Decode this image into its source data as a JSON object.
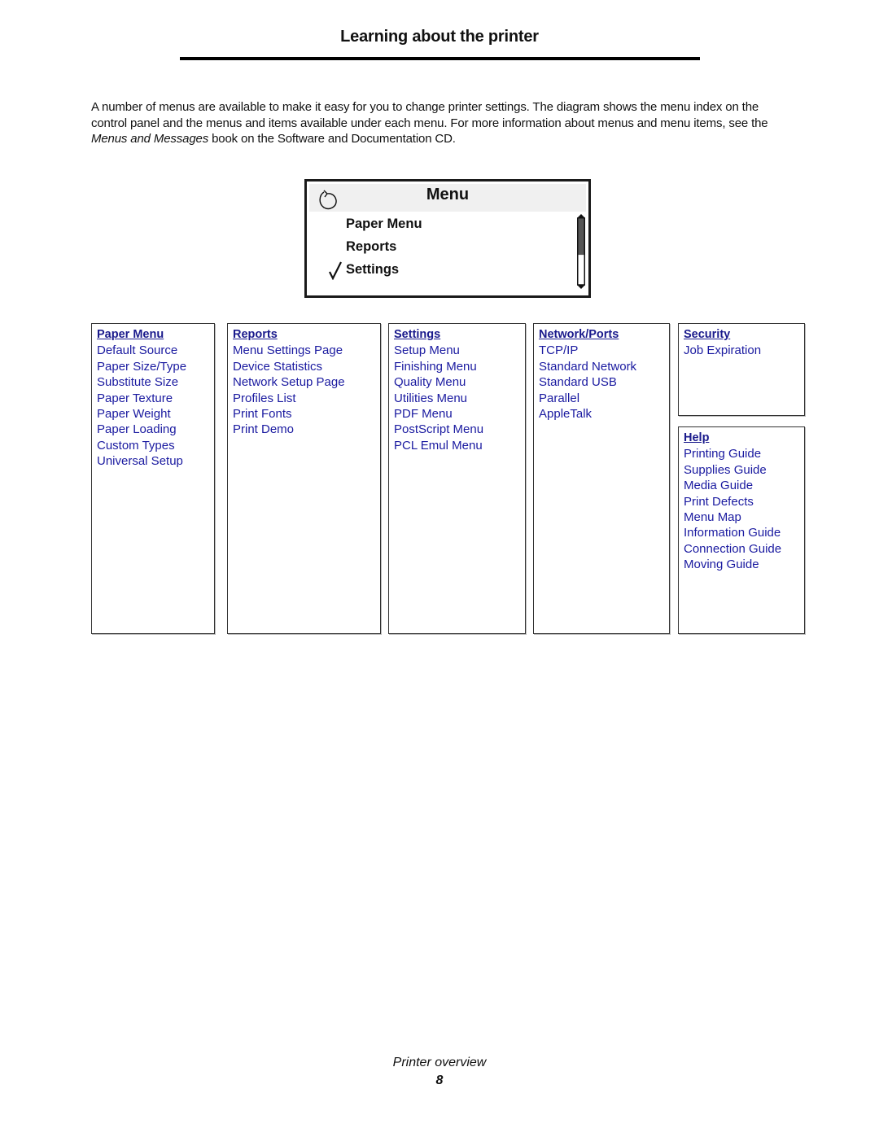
{
  "page": {
    "title": "Learning about the printer",
    "intro": {
      "before": "A number of menus are available to make it easy for you to change printer settings. The diagram shows the menu index on the control panel and the menus and items available under each menu. For more information about menus and menu items, see the ",
      "italic": "Menus and Messages",
      "after": " book on the Software and Documentation CD."
    }
  },
  "panel": {
    "title": "Menu",
    "back_icon": "back-arrow-icon",
    "items": [
      {
        "label": "Paper Menu",
        "checked": false
      },
      {
        "label": "Reports",
        "checked": false
      },
      {
        "label": "Settings",
        "checked": true
      }
    ],
    "check_icon": "checkmark-icon",
    "scroll_position": 0.55
  },
  "menus": [
    {
      "heading": "Paper Menu",
      "items": [
        "Default Source",
        "Paper Size/Type",
        "Substitute Size",
        "Paper Texture",
        "Paper Weight",
        "Paper Loading",
        "Custom Types",
        "Universal Setup"
      ]
    },
    {
      "heading": "Reports",
      "items": [
        "Menu Settings Page",
        "Device Statistics",
        "Network Setup Page",
        "Profiles List",
        "Print Fonts",
        "Print Demo"
      ]
    },
    {
      "heading": "Settings",
      "items": [
        "Setup Menu",
        "Finishing Menu",
        "Quality Menu",
        "Utilities Menu",
        "PDF Menu",
        "PostScript Menu",
        "PCL Emul Menu"
      ]
    },
    {
      "heading": "Network/Ports",
      "items": [
        "TCP/IP",
        "Standard Network",
        "Standard USB",
        "Parallel",
        "AppleTalk"
      ]
    },
    {
      "heading": "Security",
      "items": [
        "Job Expiration"
      ]
    },
    {
      "heading": "Help",
      "items": [
        "Printing Guide",
        "Supplies Guide",
        "Media Guide",
        "Print Defects",
        "Menu Map",
        "Information Guide",
        "Connection Guide",
        "Moving Guide"
      ]
    }
  ],
  "footer": {
    "section": "Printer overview",
    "page_number": "8"
  },
  "colors": {
    "link": "#1a1aa0",
    "heading_link": "#1a1a8c"
  }
}
